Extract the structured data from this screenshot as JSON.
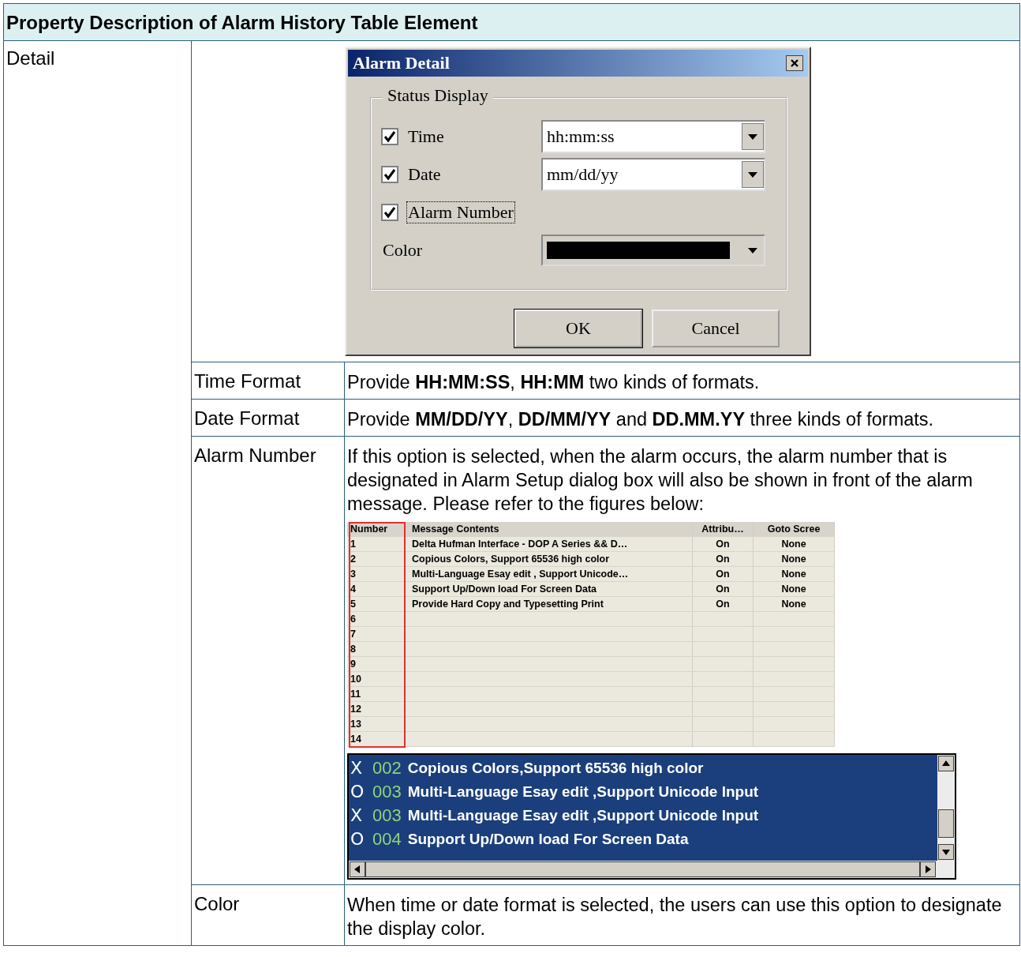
{
  "table": {
    "title": "Property Description of Alarm History Table Element",
    "section": "Detail",
    "dialog": {
      "title": "Alarm Detail",
      "group": "Status Display",
      "options": [
        {
          "kind": "checkbox-select",
          "label": "Time",
          "checked": true,
          "focused": false,
          "value": "hh:mm:ss"
        },
        {
          "kind": "checkbox-select",
          "label": "Date",
          "checked": true,
          "focused": false,
          "value": "mm/dd/yy"
        },
        {
          "kind": "checkbox",
          "label": "Alarm Number",
          "checked": true,
          "focused": true
        },
        {
          "kind": "color",
          "label": "Color",
          "color": "#000000"
        }
      ],
      "buttons": [
        "OK",
        "Cancel"
      ]
    },
    "properties": [
      {
        "name": "Time Format",
        "description": "Provide **HH:MM:SS**, **HH:MM** two kinds of formats."
      },
      {
        "name": "Date Format",
        "description": "Provide **MM/DD/YY**, **DD/MM/YY** and **DD.MM.YY** three kinds of formats."
      },
      {
        "name": "Alarm Number",
        "description": "If this option is selected, when the alarm occurs, the alarm number that is designated in Alarm Setup dialog box will also be shown in front of the alarm message. Please refer to the figures below:",
        "grid": {
          "columns": [
            "Number",
            "Message Contents",
            "Attribu…",
            "Goto Scree"
          ],
          "rows": [
            [
              "1",
              "Delta Hufman Interface -  DOP A Series && D…",
              "On",
              "None"
            ],
            [
              "2",
              "Copious Colors, Support 65536 high color",
              "On",
              "None"
            ],
            [
              "3",
              "Multi-Language Esay edit , Support  Unicode…",
              "On",
              "None"
            ],
            [
              "4",
              "Support  Up/Down load  For Screen Data",
              "On",
              "None"
            ],
            [
              "5",
              "Provide Hard Copy and Typesetting Print",
              "On",
              "None"
            ],
            [
              "6",
              "",
              "",
              ""
            ],
            [
              "7",
              "",
              "",
              ""
            ],
            [
              "8",
              "",
              "",
              ""
            ],
            [
              "9",
              "",
              "",
              ""
            ],
            [
              "10",
              "",
              "",
              ""
            ],
            [
              "11",
              "",
              "",
              ""
            ],
            [
              "12",
              "",
              "",
              ""
            ],
            [
              "13",
              "",
              "",
              ""
            ],
            [
              "14",
              "",
              "",
              ""
            ]
          ]
        },
        "alarm_list": [
          {
            "mark": "X",
            "number": "002",
            "text": "Copious Colors,Support 65536 high color"
          },
          {
            "mark": "O",
            "number": "003",
            "text": "Multi-Language Esay edit ,Support  Unicode Input"
          },
          {
            "mark": "X",
            "number": "003",
            "text": "Multi-Language Esay edit ,Support  Unicode Input"
          },
          {
            "mark": "O",
            "number": "004",
            "text": "Support  Up/Down load  For Screen Data"
          }
        ]
      },
      {
        "name": "Color",
        "description": "When time or date format is selected, the users can use this option to designate the display color."
      }
    ]
  }
}
